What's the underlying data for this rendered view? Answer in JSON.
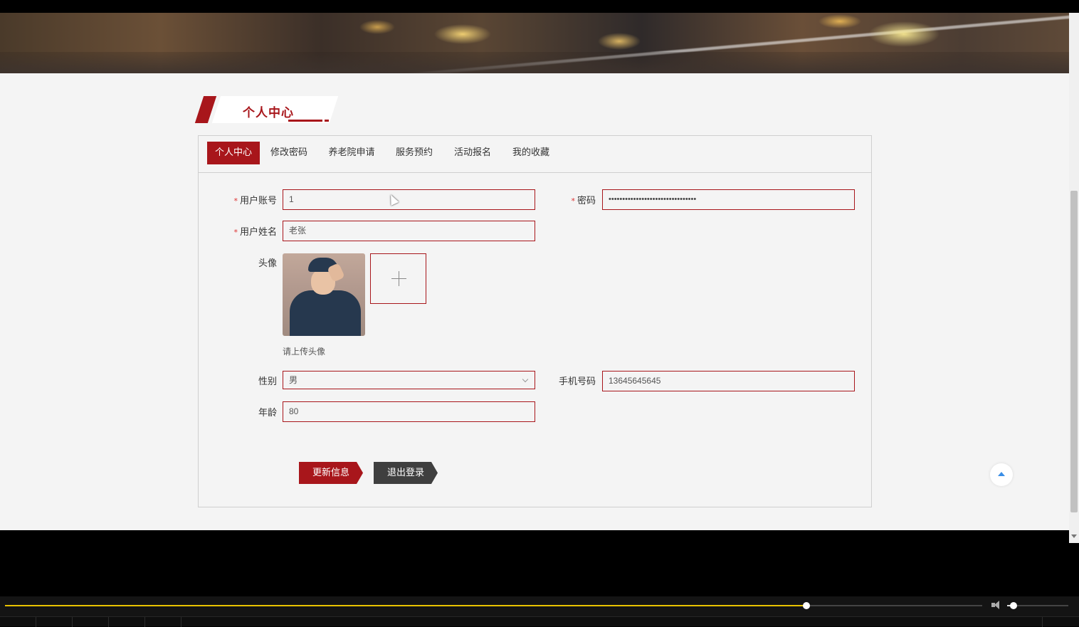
{
  "section_title": "个人中心",
  "tabs": [
    {
      "label": "个人中心",
      "active": true
    },
    {
      "label": "修改密码",
      "active": false
    },
    {
      "label": "养老院申请",
      "active": false
    },
    {
      "label": "服务预约",
      "active": false
    },
    {
      "label": "活动报名",
      "active": false
    },
    {
      "label": "我的收藏",
      "active": false
    }
  ],
  "form": {
    "account_label": "用户账号",
    "account_value": "1",
    "password_label": "密码",
    "password_value": "••••••••••••••••••••••••••••••••",
    "name_label": "用户姓名",
    "name_value": "老张",
    "avatar_label": "头像",
    "avatar_hint": "请上传头像",
    "gender_label": "性别",
    "gender_value": "男",
    "phone_label": "手机号码",
    "phone_value": "13645645645",
    "age_label": "年龄",
    "age_value": "80",
    "required_mark": "*"
  },
  "buttons": {
    "update": "更新信息",
    "logout": "退出登录"
  },
  "colors": {
    "accent": "#a8161b",
    "dark_button": "#3f3f3f",
    "page_bg": "#f4f4f4",
    "progress": "#e8c200"
  },
  "player": {
    "progress_fraction": 0.82,
    "volume_fraction": 0.1
  }
}
